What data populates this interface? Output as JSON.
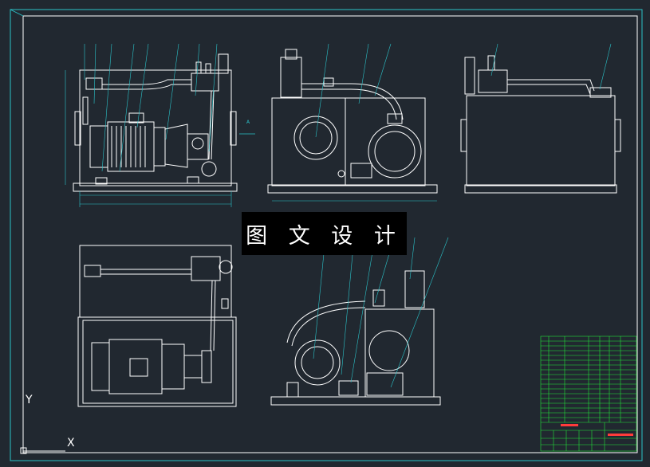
{
  "watermark": {
    "text": "图 文 设 计"
  },
  "colors": {
    "background": "#212830",
    "line": "#ffffff",
    "frame": "#2bc3c9",
    "leader": "#2bc3c9",
    "note": "#22e53a",
    "table": "#22e53a",
    "title": "#ff3b3b"
  },
  "ucs": {
    "x_label": "X",
    "y_label": "Y"
  },
  "view_marker": "A"
}
